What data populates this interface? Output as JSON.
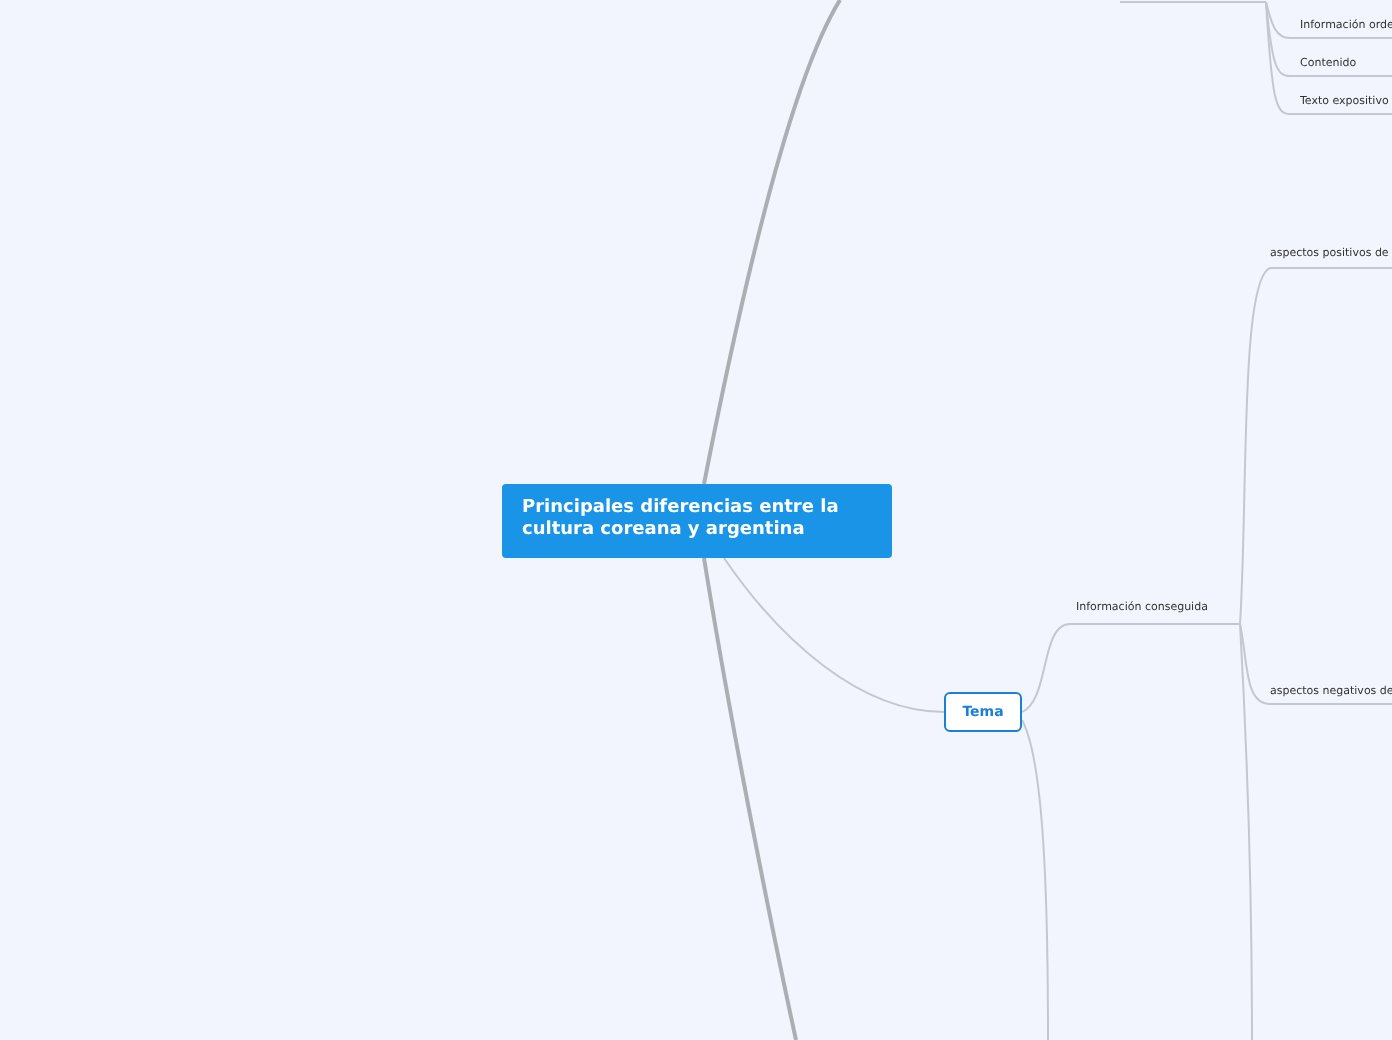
{
  "central_topic": {
    "text": "Principales diferencias entre la cultura coreana y argentina"
  },
  "upper_branch": {
    "children": [
      {
        "text": "Información orde"
      },
      {
        "text": "Contenido"
      },
      {
        "text": "Texto expositivo"
      }
    ]
  },
  "topic": {
    "text": "Tema",
    "children": [
      {
        "text": "Información conseguida",
        "children": [
          {
            "text": "aspectos positivos de"
          },
          {
            "text": "aspectos negativos de"
          }
        ]
      }
    ]
  }
}
